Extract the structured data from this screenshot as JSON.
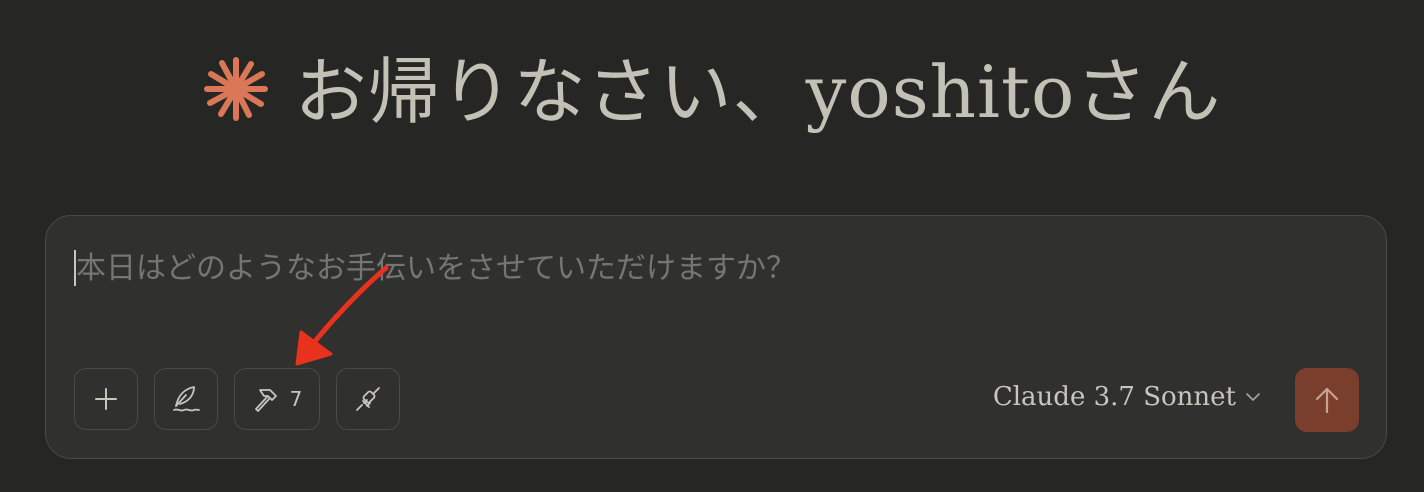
{
  "greeting": {
    "text": "お帰りなさい、yoshitoさん",
    "icon": "claude-spark-icon",
    "icon_color": "#d97757"
  },
  "composer": {
    "placeholder": "本日はどのようなお手伝いをさせていただけますか？",
    "value": ""
  },
  "toolbar": {
    "add_icon": "plus-icon",
    "style_icon": "feather-icon",
    "tools_icon": "hammer-icon",
    "tools_count": "7",
    "connect_icon": "plug-icon"
  },
  "model": {
    "name": "Claude 3.7 Sonnet",
    "dropdown_icon": "chevron-down-icon"
  },
  "send": {
    "icon": "arrow-up-icon",
    "color": "#7a3f2c"
  },
  "annotation": {
    "color": "#e8321e"
  }
}
